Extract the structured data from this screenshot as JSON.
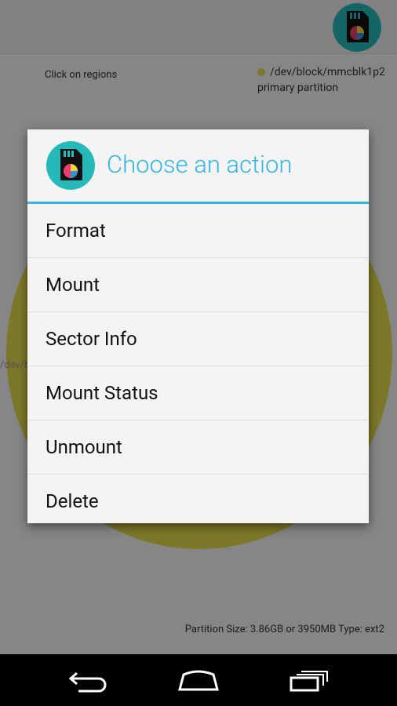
{
  "header": {
    "icon": "sd-card-pie-icon"
  },
  "content": {
    "hint": "Click on regions",
    "legend_device": "/dev/block/mmcblk1p2",
    "legend_type": "primary partition",
    "disk_label": "/dev/bl",
    "partition_info": "Partition Size: 3.86GB or 3950MB   Type: ext2"
  },
  "dialog": {
    "title": "Choose an action",
    "icon": "sd-card-pie-icon",
    "items": [
      "Format",
      "Mount",
      "Sector Info",
      "Mount Status",
      "Unmount",
      "Delete"
    ]
  },
  "nav": {
    "back": "back-icon",
    "home": "home-icon",
    "recents": "recents-icon"
  },
  "colors": {
    "accent": "#33b5e5",
    "partition": "#e4da4c",
    "icon_bg": "#26b9ba"
  }
}
